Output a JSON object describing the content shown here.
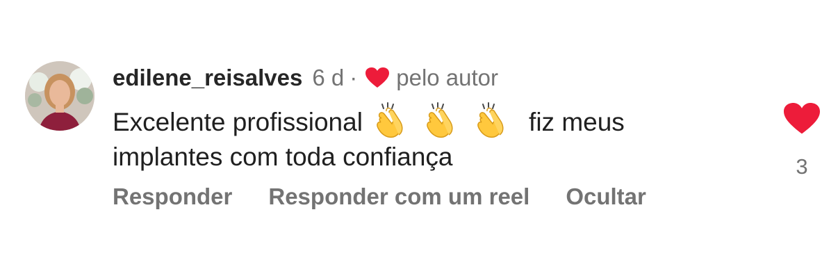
{
  "comment": {
    "username": "edilene_reisalves",
    "time_ago": "6 d",
    "separator": "·",
    "liked_by_author_label": "pelo autor",
    "text_before_emoji": "Excelente profissional",
    "text_after_emoji": "fiz meus implantes com toda confiança",
    "emoji": [
      "clapping-hands",
      "clapping-hands",
      "clapping-hands"
    ],
    "like_count": "3",
    "liked": true
  },
  "actions": {
    "reply": "Responder",
    "reply_with_reel": "Responder com um reel",
    "hide": "Ocultar"
  },
  "colors": {
    "heart": "#ed1c3a",
    "primary_text": "#262626",
    "secondary_text": "#737373"
  }
}
